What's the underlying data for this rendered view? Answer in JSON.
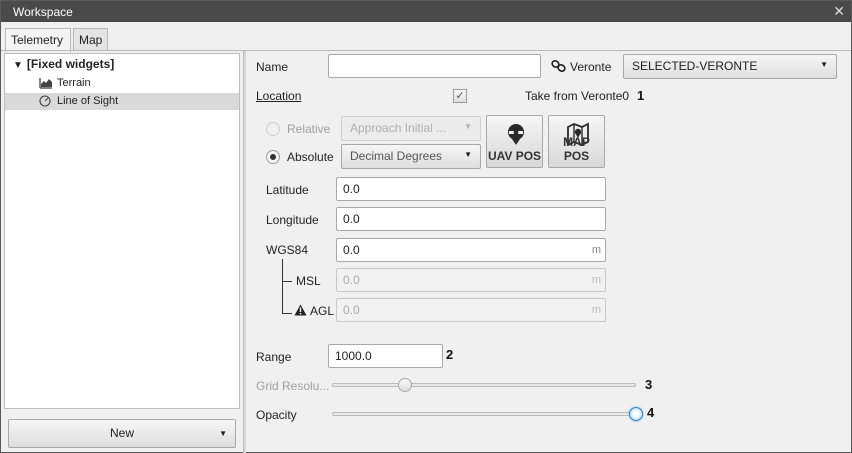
{
  "window": {
    "title": "Workspace",
    "close_glyph": "✕"
  },
  "tabs": [
    {
      "label": "Telemetry",
      "active": true
    },
    {
      "label": "Map",
      "active": false
    }
  ],
  "tree": {
    "root_label": "[Fixed widgets]",
    "items": [
      {
        "label": "Terrain",
        "icon": "terrain-chart-icon",
        "selected": false
      },
      {
        "label": "Line of Sight",
        "icon": "gauge-icon",
        "selected": true
      }
    ]
  },
  "new_button": {
    "label": "New"
  },
  "form": {
    "name": {
      "label": "Name",
      "value": ""
    },
    "veronte": {
      "label": "Veronte",
      "value": "SELECTED-VERONTE",
      "icon": "link-icon"
    },
    "location": {
      "label": "Location",
      "checked": true,
      "take_from_label": "Take from Veronte0"
    },
    "relative": {
      "label": "Relative",
      "select_value": "Approach Initial ...",
      "enabled": false
    },
    "absolute": {
      "label": "Absolute",
      "select_value": "Decimal Degrees",
      "checked": true
    },
    "uav_pos": {
      "label": "UAV POS",
      "icon": "drone-pin-icon"
    },
    "map_pos": {
      "label": "MAP POS",
      "icon": "map-pin-icon"
    },
    "latitude": {
      "label": "Latitude",
      "value": "0.0"
    },
    "longitude": {
      "label": "Longitude",
      "value": "0.0"
    },
    "wgs84": {
      "label": "WGS84",
      "value": "0.0",
      "unit": "m"
    },
    "msl": {
      "label": "MSL",
      "value": "0.0",
      "unit": "m"
    },
    "agl": {
      "label": "AGL",
      "value": "0.0",
      "unit": "m",
      "icon": "warning-icon"
    },
    "range": {
      "label": "Range",
      "value": "1000.0"
    },
    "grid_resolution": {
      "label": "Grid Resolu...",
      "level": 0.24
    },
    "opacity": {
      "label": "Opacity",
      "level": 1.0
    }
  },
  "callouts": {
    "c1": "1",
    "c2": "2",
    "c3": "3",
    "c4": "4"
  }
}
